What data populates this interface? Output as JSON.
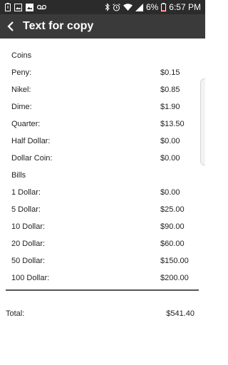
{
  "status": {
    "battery_percent": "6%",
    "time": "6:57 PM"
  },
  "app_bar": {
    "title": "Text for copy"
  },
  "coins": {
    "header": "Coins",
    "items": [
      {
        "label": "Peny:",
        "value": "$0.15"
      },
      {
        "label": "Nikel:",
        "value": "$0.85"
      },
      {
        "label": "Dime:",
        "value": "$1.90"
      },
      {
        "label": "Quarter:",
        "value": "$13.50"
      },
      {
        "label": "Half Dollar:",
        "value": "$0.00"
      },
      {
        "label": "Dollar Coin:",
        "value": "$0.00"
      }
    ]
  },
  "bills": {
    "header": "Bills",
    "items": [
      {
        "label": "1 Dollar:",
        "value": "$0.00"
      },
      {
        "label": "5 Dollar:",
        "value": "$25.00"
      },
      {
        "label": "10 Dollar:",
        "value": "$90.00"
      },
      {
        "label": "20 Dollar:",
        "value": "$60.00"
      },
      {
        "label": "50 Dollar:",
        "value": "$150.00"
      },
      {
        "label": "100 Dollar:",
        "value": "$200.00"
      }
    ]
  },
  "total": {
    "label": "Total:",
    "value": "$541.40"
  },
  "icons": {
    "status_left": [
      "battery-alert-icon",
      "image-icon",
      "photo-icon",
      "voicemail-icon"
    ],
    "status_right": [
      "bluetooth-icon",
      "alarm-icon",
      "wifi-icon",
      "signal-icon",
      "battery-icon"
    ],
    "back": "arrow-back-icon"
  }
}
